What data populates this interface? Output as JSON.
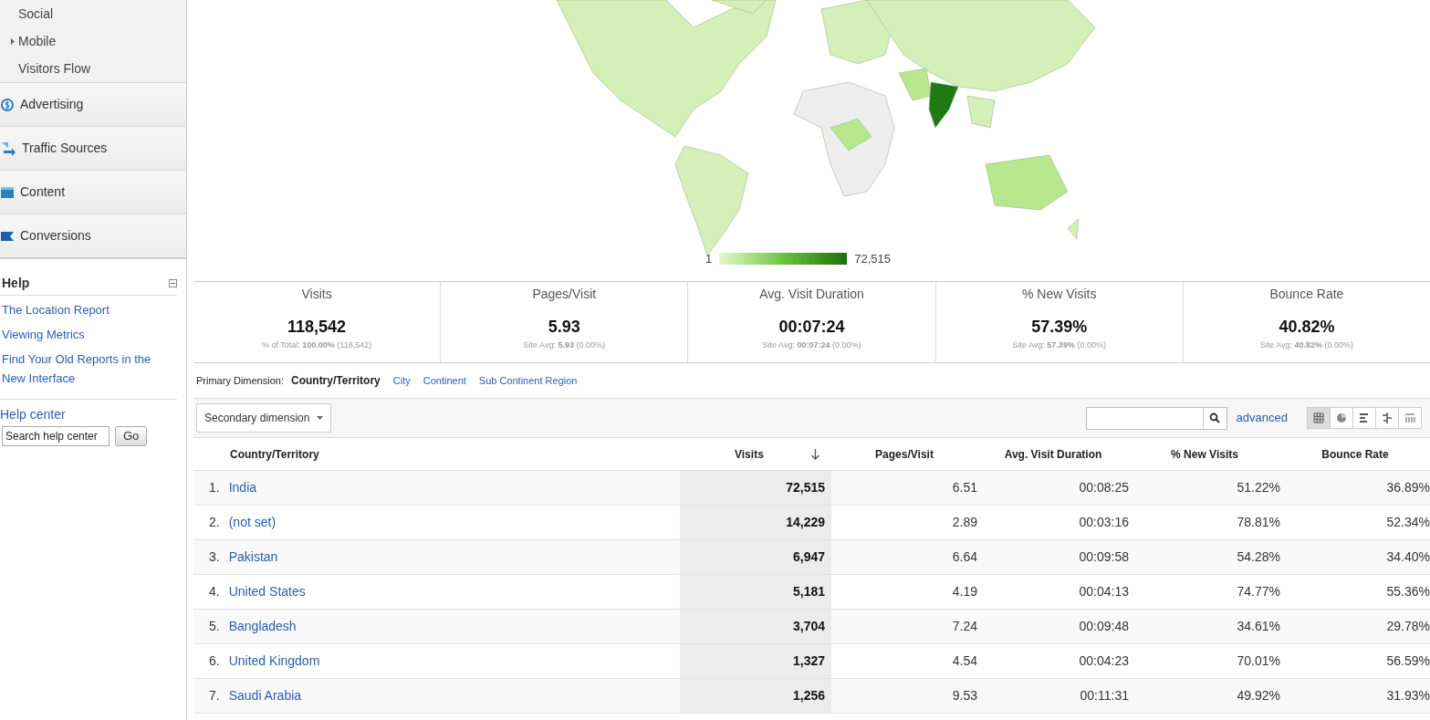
{
  "sidebar": {
    "nav_items": [
      {
        "kind": "sub",
        "label": "Social",
        "expandable": false
      },
      {
        "kind": "sub",
        "label": "Mobile",
        "expandable": true
      },
      {
        "kind": "sub",
        "label": "Visitors Flow",
        "expandable": false
      },
      {
        "kind": "section",
        "label": "Advertising"
      },
      {
        "kind": "section",
        "label": "Traffic Sources"
      },
      {
        "kind": "section",
        "label": "Content"
      },
      {
        "kind": "section",
        "label": "Conversions"
      }
    ],
    "help": {
      "title": "Help",
      "links": [
        "The Location Report",
        "Viewing Metrics",
        "Find Your Old Reports in the New Interface"
      ],
      "help_center": "Help center",
      "search_placeholder": "Search help center",
      "go": "Go"
    }
  },
  "map": {
    "legend_min": "1",
    "legend_max": "72,515"
  },
  "scorecards": [
    {
      "label": "Visits",
      "value": "118,542",
      "note": "% of Total: **100.00%** (118,542)"
    },
    {
      "label": "Pages/Visit",
      "value": "5.93",
      "note": "Site Avg: **5.93** (0.00%)"
    },
    {
      "label": "Avg. Visit Duration",
      "value": "00:07:24",
      "note": "Site Avg: **00:07:24** (0.00%)"
    },
    {
      "label": "% New Visits",
      "value": "57.39%",
      "note": "Site Avg: **57.39%** (0.00%)"
    },
    {
      "label": "Bounce Rate",
      "value": "40.82%",
      "note": "Site Avg: **40.82%** (0.00%)"
    }
  ],
  "primary_dimension": {
    "label": "Primary Dimension:",
    "options": [
      {
        "label": "Country/Territory",
        "selected": true
      },
      {
        "label": "City",
        "selected": false
      },
      {
        "label": "Continent",
        "selected": false
      },
      {
        "label": "Sub Continent Region",
        "selected": false
      }
    ]
  },
  "toolbar": {
    "secondary_dimension": "Secondary dimension",
    "advanced": "advanced",
    "views": [
      {
        "selected": true
      },
      {
        "selected": false
      },
      {
        "selected": false
      },
      {
        "selected": false
      },
      {
        "selected": false
      }
    ]
  },
  "table": {
    "columns": [
      "Country/Territory",
      "Visits",
      "Pages/Visit",
      "Avg. Visit Duration",
      "% New Visits",
      "Bounce Rate"
    ],
    "rows": [
      {
        "index": "1.",
        "country": "India",
        "visits": "72,515",
        "pages": "6.51",
        "duration": "00:08:25",
        "new": "51.22%",
        "bounce": "36.89%"
      },
      {
        "index": "2.",
        "country": "(not set)",
        "visits": "14,229",
        "pages": "2.89",
        "duration": "00:03:16",
        "new": "78.81%",
        "bounce": "52.34%"
      },
      {
        "index": "3.",
        "country": "Pakistan",
        "visits": "6,947",
        "pages": "6.64",
        "duration": "00:09:58",
        "new": "54.28%",
        "bounce": "34.40%"
      },
      {
        "index": "4.",
        "country": "United States",
        "visits": "5,181",
        "pages": "4.19",
        "duration": "00:04:13",
        "new": "74.77%",
        "bounce": "55.36%"
      },
      {
        "index": "5.",
        "country": "Bangladesh",
        "visits": "3,704",
        "pages": "7.24",
        "duration": "00:09:48",
        "new": "34.61%",
        "bounce": "29.78%"
      },
      {
        "index": "6.",
        "country": "United Kingdom",
        "visits": "1,327",
        "pages": "4.54",
        "duration": "00:04:23",
        "new": "70.01%",
        "bounce": "56.59%"
      },
      {
        "index": "7.",
        "country": "Saudi Arabia",
        "visits": "1,256",
        "pages": "9.53",
        "duration": "00:11:31",
        "new": "49.92%",
        "bounce": "31.93%"
      }
    ]
  }
}
